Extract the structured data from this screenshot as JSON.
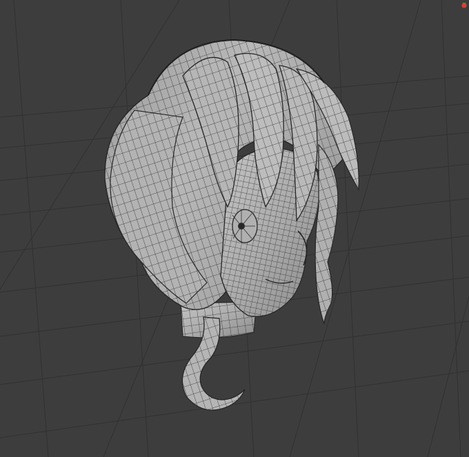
{
  "viewport": {
    "background_color": "#3d3d3d",
    "grid_line_color": "#303030",
    "mesh_fill_color": "#a9a9a9",
    "mesh_shadow_color": "#8a8a8a",
    "mesh_highlight_color": "#c4c4c4",
    "wire_color": "#262626",
    "object": "anime-head-with-hair-wireframe-mesh"
  },
  "corner_icon": {
    "icon": "strawberry-icon",
    "colors": [
      "#e53935",
      "#43a047"
    ]
  }
}
